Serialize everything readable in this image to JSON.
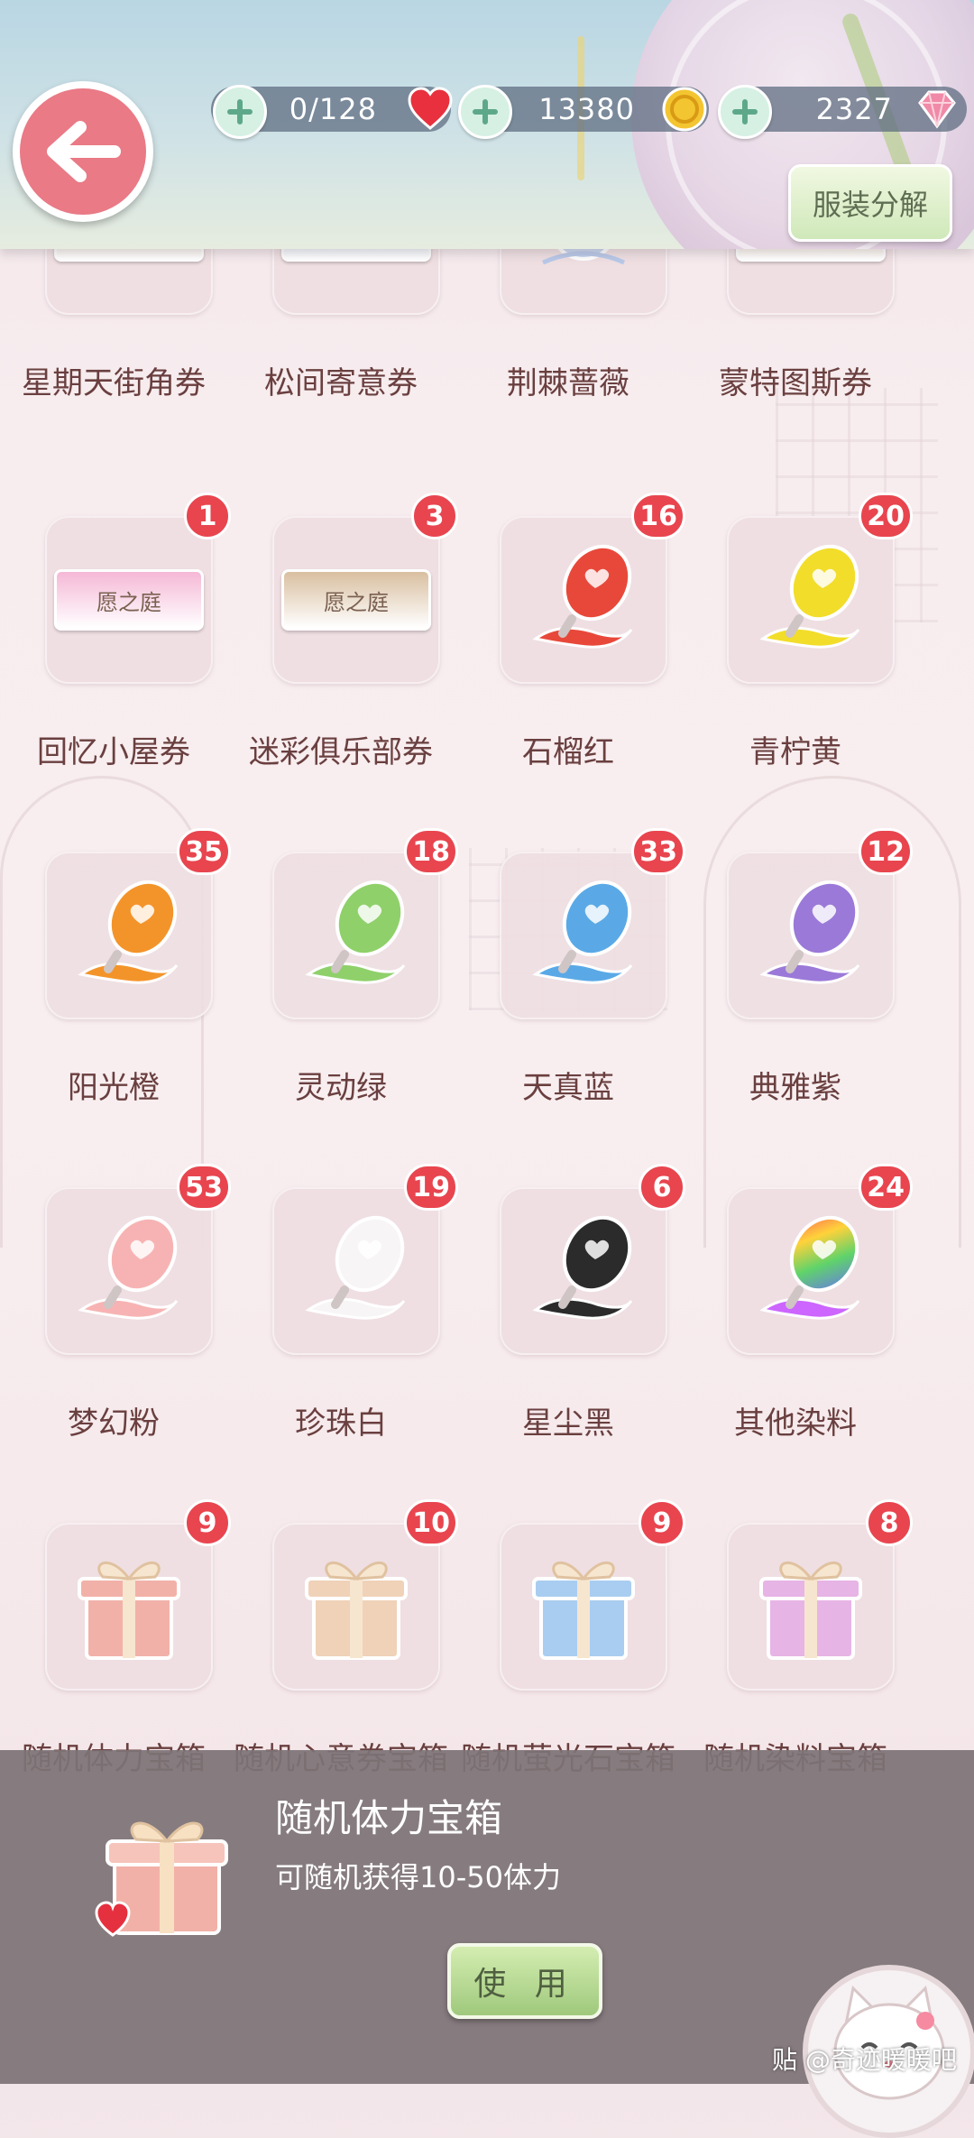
{
  "header": {
    "stamina": "0/128",
    "gold": "13380",
    "diamonds": "2327",
    "decompose_label": "服装分解"
  },
  "ticket_text": "愿之庭",
  "items": [
    {
      "name": "星期天街角券",
      "count": null,
      "kind": "ticket",
      "color": "#e6c9a8"
    },
    {
      "name": "松间寄意券",
      "count": null,
      "kind": "ticket",
      "color": "#bcd5f0"
    },
    {
      "name": "荆棘蔷薇",
      "count": null,
      "kind": "rose",
      "color": "#c9d6ef"
    },
    {
      "name": "蒙特图斯券",
      "count": null,
      "kind": "ticket",
      "color": "#f0c9a0"
    },
    {
      "name": "回忆小屋券",
      "count": "1",
      "kind": "ticket",
      "color": "#f5b8d6"
    },
    {
      "name": "迷彩俱乐部券",
      "count": "3",
      "kind": "ticket",
      "color": "#d9bfa0"
    },
    {
      "name": "石榴红",
      "count": "16",
      "kind": "dye",
      "color": "#e8483a"
    },
    {
      "name": "青柠黄",
      "count": "20",
      "kind": "dye",
      "color": "#f2dd2a"
    },
    {
      "name": "阳光橙",
      "count": "35",
      "kind": "dye",
      "color": "#f3942a"
    },
    {
      "name": "灵动绿",
      "count": "18",
      "kind": "dye",
      "color": "#8fd06a"
    },
    {
      "name": "天真蓝",
      "count": "33",
      "kind": "dye",
      "color": "#5aa9e6"
    },
    {
      "name": "典雅紫",
      "count": "12",
      "kind": "dye",
      "color": "#9b79d8"
    },
    {
      "name": "梦幻粉",
      "count": "53",
      "kind": "dye",
      "color": "#f7b3b3"
    },
    {
      "name": "珍珠白",
      "count": "19",
      "kind": "dye",
      "color": "#f7f5f5"
    },
    {
      "name": "星尘黑",
      "count": "6",
      "kind": "dye",
      "color": "#2b2b2b"
    },
    {
      "name": "其他染料",
      "count": "24",
      "kind": "rainbow",
      "color": "#cc66ff"
    },
    {
      "name": "随机体力宝箱",
      "count": "9",
      "kind": "gift",
      "color": "#f2b1a8"
    },
    {
      "name": "随机心意券宝箱",
      "count": "10",
      "kind": "gift",
      "color": "#f0d2b8"
    },
    {
      "name": "随机萤光石宝箱",
      "count": "9",
      "kind": "gift",
      "color": "#a9cdf0"
    },
    {
      "name": "随机染料宝箱",
      "count": "8",
      "kind": "gift",
      "color": "#e7b4e6"
    }
  ],
  "detail": {
    "title": "随机体力宝箱",
    "description": "可随机获得10-50体力",
    "use_label": "使 用"
  },
  "watermark": "贴 @奇迹暖暖吧"
}
